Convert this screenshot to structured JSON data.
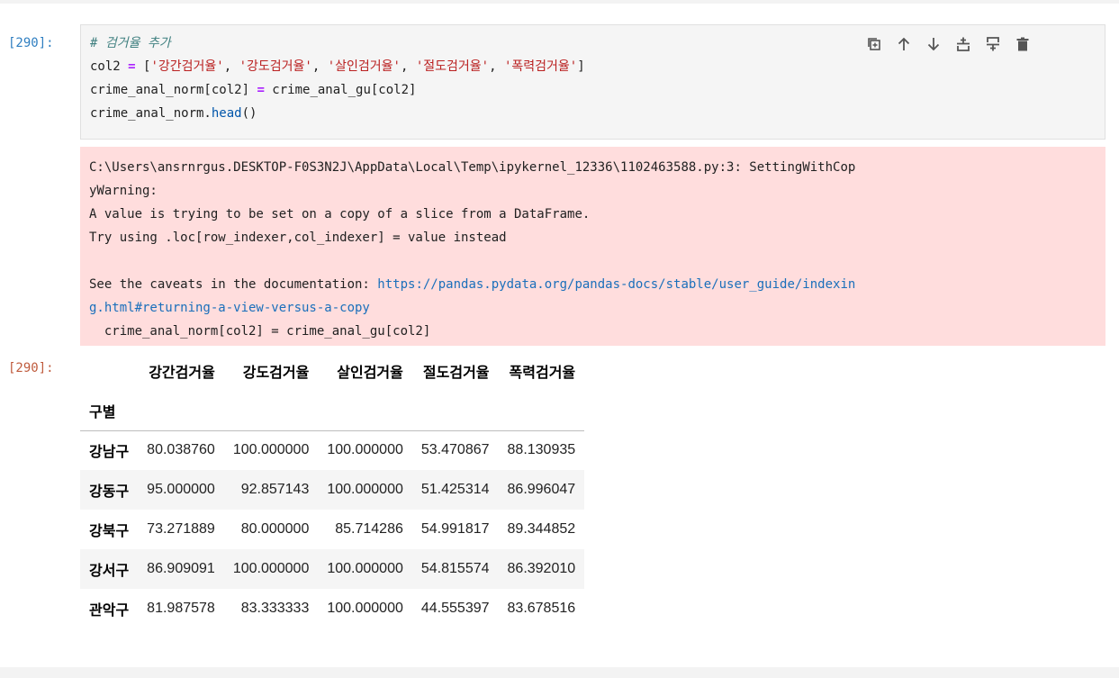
{
  "cell": {
    "input_prompt": "[290]:",
    "output_prompt": "[290]:",
    "code": {
      "comment": "# 검거율 추가",
      "line2_pre": "col2 ",
      "line2_eq": "=",
      "line2_open": " [",
      "str1": "'강간검거율'",
      "str2": "'강도검거율'",
      "str3": "'살인검거율'",
      "str4": "'절도검거율'",
      "str5": "'폭력검거율'",
      "sep": ", ",
      "line2_close": "]",
      "line3_pre": "crime_anal_norm[col2] ",
      "line3_eq": "=",
      "line3_post": " crime_anal_gu[col2]",
      "line4_obj": "crime_anal_norm.",
      "line4_fn": "head",
      "line4_paren": "()"
    }
  },
  "toolbar": {
    "icons": [
      "duplicate-icon",
      "arrow-up-icon",
      "arrow-down-icon",
      "insert-above-icon",
      "insert-below-icon",
      "trash-icon"
    ]
  },
  "stderr": {
    "line1": "C:\\Users\\ansrnrgus.DESKTOP-F0S3N2J\\AppData\\Local\\Temp\\ipykernel_12336\\1102463588.py:3: SettingWithCop",
    "line2": "yWarning:",
    "line3": "A value is trying to be set on a copy of a slice from a DataFrame.",
    "line4": "Try using .loc[row_indexer,col_indexer] = value instead",
    "line6_pre": "See the caveats in the documentation: ",
    "link_part1": "https://pandas.pydata.org/pandas-docs/stable/user_guide/indexin",
    "link_part2": "g.html#returning-a-view-versus-a-copy",
    "line8": "  crime_anal_norm[col2] = crime_anal_gu[col2]"
  },
  "dataframe": {
    "columns": [
      "강간검거율",
      "강도검거율",
      "살인검거율",
      "절도검거율",
      "폭력검거율"
    ],
    "index_name": "구별",
    "rows": [
      {
        "index": "강남구",
        "values": [
          "80.038760",
          "100.000000",
          "100.000000",
          "53.470867",
          "88.130935"
        ]
      },
      {
        "index": "강동구",
        "values": [
          "95.000000",
          "92.857143",
          "100.000000",
          "51.425314",
          "86.996047"
        ]
      },
      {
        "index": "강북구",
        "values": [
          "73.271889",
          "80.000000",
          "85.714286",
          "54.991817",
          "89.344852"
        ]
      },
      {
        "index": "강서구",
        "values": [
          "86.909091",
          "100.000000",
          "100.000000",
          "54.815574",
          "86.392010"
        ]
      },
      {
        "index": "관악구",
        "values": [
          "81.987578",
          "83.333333",
          "100.000000",
          "44.555397",
          "83.678516"
        ]
      }
    ]
  }
}
